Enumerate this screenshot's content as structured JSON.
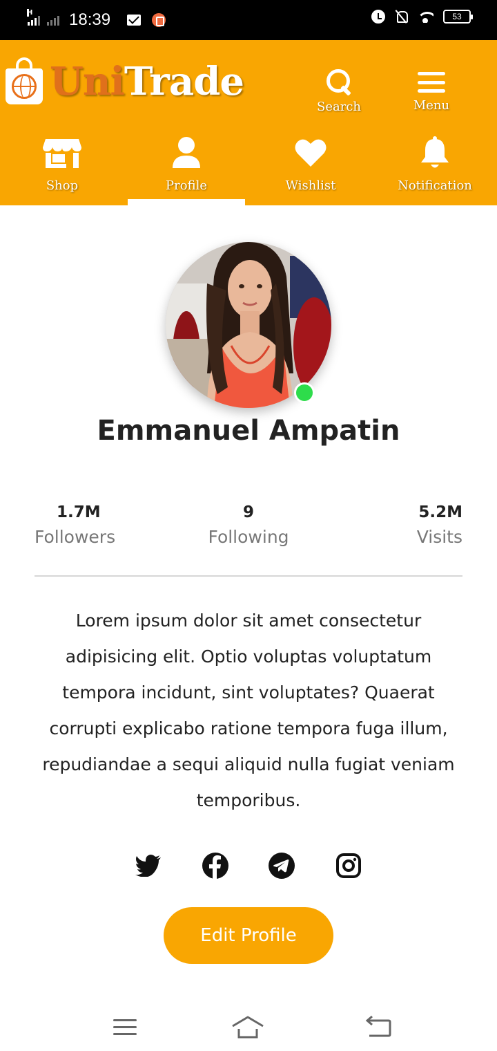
{
  "status_bar": {
    "time": "18:39",
    "network_letter": "H",
    "battery": "53"
  },
  "header": {
    "brand_part1": "Uni",
    "brand_part2": "Trade",
    "search_label": "Search",
    "menu_label": "Menu"
  },
  "nav": {
    "tabs": [
      {
        "label": "Shop",
        "icon": "shop-icon",
        "active": false
      },
      {
        "label": "Profile",
        "icon": "user-icon",
        "active": true
      },
      {
        "label": "Wishlist",
        "icon": "heart-icon",
        "active": false
      },
      {
        "label": "Notification",
        "icon": "bell-icon",
        "active": false
      }
    ]
  },
  "profile": {
    "name": "Emmanuel Ampatin",
    "online": true,
    "stats": [
      {
        "value": "1.7M",
        "label": "Followers"
      },
      {
        "value": "9",
        "label": "Following"
      },
      {
        "value": "5.2M",
        "label": "Visits"
      }
    ],
    "bio": "Lorem ipsum dolor sit amet consectetur adipisicing elit. Optio voluptas voluptatum tempora incidunt, sint voluptates? Quaerat corrupti explicabo ratione tempora fuga illum, repudiandae a sequi aliquid nulla fugiat veniam temporibus.",
    "socials": [
      "twitter-icon",
      "facebook-icon",
      "telegram-icon",
      "instagram-icon"
    ],
    "edit_button": "Edit Profile"
  },
  "colors": {
    "brand_orange": "#f9a602",
    "logo_accent": "#e0701b",
    "online_green": "#2edc4b"
  }
}
